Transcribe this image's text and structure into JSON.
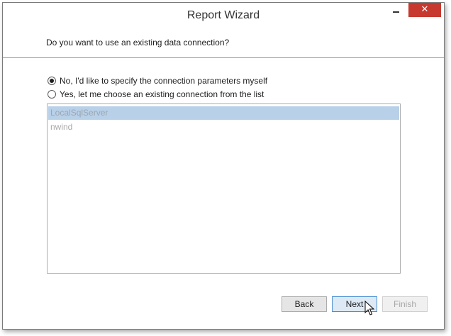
{
  "window": {
    "title": "Report Wizard",
    "minimize_icon": "minimize-icon",
    "close_icon": "close-icon",
    "close_glyph": "✕"
  },
  "header": {
    "question": "Do you want to use an existing data connection?"
  },
  "options": [
    {
      "label": "No, I'd like to specify the connection parameters myself",
      "checked": true
    },
    {
      "label": "Yes, let me choose an existing connection from the list",
      "checked": false
    }
  ],
  "connections": {
    "items": [
      "LocalSqlServer",
      "nwind"
    ],
    "selected_index": 0,
    "enabled": false
  },
  "buttons": {
    "back_label": "Back",
    "next_label": "Next",
    "finish_label": "Finish",
    "finish_enabled": false
  },
  "colors": {
    "close_button": "#c7392e",
    "selection": "#b8d0e8",
    "focused_button_border": "#4a90d0"
  }
}
